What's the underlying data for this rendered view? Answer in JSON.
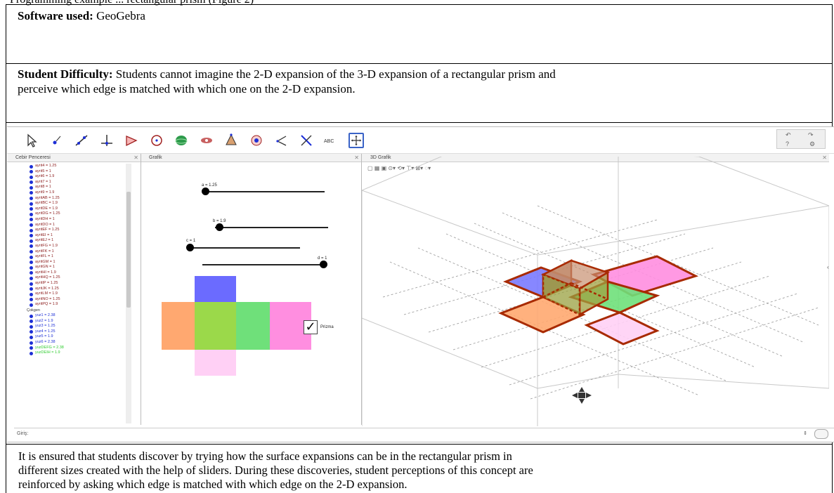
{
  "caption_top": "Programming example ... rectangular prism (Figure 2)",
  "software": {
    "label": "Software used:",
    "value": "GeoGebra"
  },
  "difficulty": {
    "label": "Student Difficulty:",
    "line1": "Students cannot imagine the 2-D expansion of the 3-D expansion of a rectangular prism and",
    "line2": "perceive which edge is matched with which one on the 2-D expansion."
  },
  "app": {
    "algebra_title": "Cebir Penceresi",
    "graphics_title": "Grafik",
    "view3d_title": "3D Grafik",
    "tools": [
      "move-tool",
      "point-tool",
      "line-tool",
      "perpendicular-tool",
      "polygon-tool",
      "circle-tool",
      "sphere-tool",
      "extrude-tool",
      "pyramid-tool",
      "angle-tool",
      "reflect-tool",
      "slider-tool",
      "text-tool",
      "move-view-tool"
    ],
    "text_tool_label": "ABC",
    "algebra_items": [
      {
        "t": "ayrit4 = 1.25"
      },
      {
        "t": "ayrit5 = 1"
      },
      {
        "t": "ayrit6 = 1.9"
      },
      {
        "t": "ayrit7 = 1"
      },
      {
        "t": "ayrit8 = 1"
      },
      {
        "t": "ayrit9 = 1.9"
      },
      {
        "t": "ayritAB = 1.25"
      },
      {
        "t": "ayritBC = 1.9"
      },
      {
        "t": "ayritDE = 1.9"
      },
      {
        "t": "ayritDG = 1.25"
      },
      {
        "t": "ayritDH = 1"
      },
      {
        "t": "ayritDO = 1"
      },
      {
        "t": "ayritEF = 1.25"
      },
      {
        "t": "ayritEI = 1"
      },
      {
        "t": "ayritEJ = 1"
      },
      {
        "t": "ayritFG = 1.9"
      },
      {
        "t": "ayritFK = 1"
      },
      {
        "t": "ayritFL = 1"
      },
      {
        "t": "ayritGM = 1"
      },
      {
        "t": "ayritGN = 1"
      },
      {
        "t": "ayritHI = 1.9"
      },
      {
        "t": "ayritHQ = 1.25"
      },
      {
        "t": "ayritIP = 1.25"
      },
      {
        "t": "ayritJK = 1.25"
      },
      {
        "t": "ayritLM = 1.9"
      },
      {
        "t": "ayritNO = 1.25"
      },
      {
        "t": "ayritPQ = 1.9"
      }
    ],
    "algebra_group": "Çokgen",
    "algebra_items2": [
      {
        "t": "yuz1 = 2.38",
        "c": "blue"
      },
      {
        "t": "yuz2 = 1.9",
        "c": "blue"
      },
      {
        "t": "yuz3 = 1.25",
        "c": "blue"
      },
      {
        "t": "yuz4 = 1.25",
        "c": "blue"
      },
      {
        "t": "yuz5 = 1.9",
        "c": "blue"
      },
      {
        "t": "yuz6 = 2.38",
        "c": "blue"
      },
      {
        "t": "yuzDEFG = 2.38",
        "c": "green"
      },
      {
        "t": "yuzDEIH = 1.9",
        "c": "green"
      }
    ],
    "sliders": [
      {
        "label": "a = 1.25",
        "value": 1.25
      },
      {
        "label": "b = 1.9",
        "value": 1.9
      },
      {
        "label": "c = 1",
        "value": 1
      },
      {
        "label": "d = 1",
        "value": 1
      }
    ],
    "checkbox_label": "Prizma",
    "checkbox_checked": true,
    "input_label": "Giriş:",
    "colors": {
      "orange": "#ffa870",
      "green1": "#9bd94a",
      "green2": "#6fe07a",
      "blue": "#6b6bff",
      "pink": "#ff8ee0",
      "pink_light": "#ffd0f5",
      "edge": "#a82a00"
    }
  },
  "bottom": {
    "line1": "It is ensured that students discover by trying how the surface expansions can be in the rectangular prism in",
    "line2": "different sizes created with the help of sliders. During these discoveries, student perceptions of this concept are",
    "line3": "reinforced by asking which edge is matched with which edge on the 2-D expansion."
  }
}
